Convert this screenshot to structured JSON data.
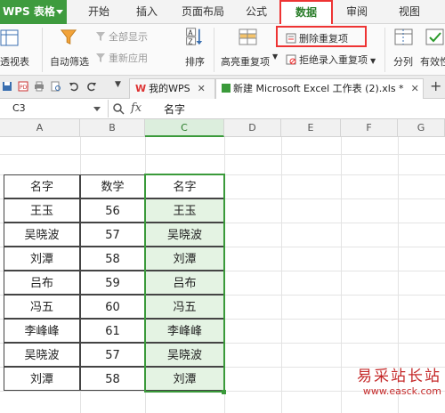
{
  "app_button": "WPS 表格",
  "menu": [
    "开始",
    "插入",
    "页面布局",
    "公式",
    "数据",
    "审阅",
    "视图"
  ],
  "active_menu": "数据",
  "ribbon": {
    "pivot": "透视表",
    "autofilter": "自动筛选",
    "show_all": "全部显示",
    "reapply": "重新应用",
    "sort": "排序",
    "highlight_dup": "高亮重复项",
    "remove_dup": "删除重复项",
    "reject_dup": "拒绝录入重复项",
    "split": "分列",
    "validity": "有效性"
  },
  "tabs": {
    "my_wps": "我的WPS",
    "doc": "新建 Microsoft Excel 工作表 (2).xls *"
  },
  "formula_bar": {
    "cell_ref": "C3",
    "fx": "fx",
    "content": "名字"
  },
  "columns": [
    "A",
    "B",
    "C",
    "D",
    "E",
    "F",
    "G"
  ],
  "table": {
    "headers": [
      "名字",
      "数学",
      "名字"
    ],
    "rows": [
      [
        "王玉",
        "56",
        "王玉"
      ],
      [
        "吴晓波",
        "57",
        "吴晓波"
      ],
      [
        "刘潭",
        "58",
        "刘潭"
      ],
      [
        "吕布",
        "59",
        "吕布"
      ],
      [
        "冯五",
        "60",
        "冯五"
      ],
      [
        "李峰峰",
        "61",
        "李峰峰"
      ],
      [
        "吴晓波",
        "57",
        "吴晓波"
      ],
      [
        "刘潭",
        "58",
        "刘潭"
      ]
    ]
  },
  "watermark": {
    "cn": "易采站长站",
    "url": "www.easck.com"
  }
}
